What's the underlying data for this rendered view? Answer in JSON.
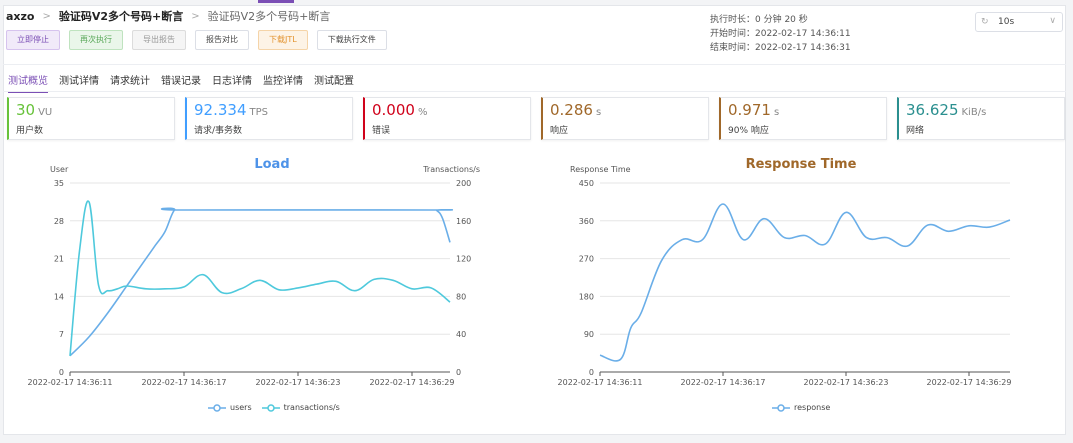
{
  "breadcrumb": {
    "project": "axzo",
    "scenario": "验证码V2多个号码+断言",
    "report": "验证码V2多个号码+断言"
  },
  "buttons": {
    "stop": "立即停止",
    "rerun": "再次执行",
    "export": "导出报告",
    "compare": "报告对比",
    "download_jtl": "下载JTL",
    "download_files": "下载执行文件"
  },
  "info": {
    "duration": "执行时长：0 分钟 20 秒",
    "start": "开始时间：2022-02-17 14:36:11",
    "end": "结束时间：2022-02-17 14:36:31"
  },
  "refresh_select": {
    "value": "10s"
  },
  "tabs": [
    "测试概览",
    "测试详情",
    "请求统计",
    "错误记录",
    "日志详情",
    "监控详情",
    "测试配置"
  ],
  "metrics": [
    {
      "value": "30",
      "unit": "VU",
      "label": "用户数",
      "color": "#67c23a"
    },
    {
      "value": "92.334",
      "unit": "TPS",
      "label": "请求/事务数",
      "color": "#409eff"
    },
    {
      "value": "0.000",
      "unit": "%",
      "label": "错误",
      "color": "#d0021b"
    },
    {
      "value": "0.286",
      "unit": "s",
      "label": "响应",
      "color": "#a0682a"
    },
    {
      "value": "0.971",
      "unit": "s",
      "label": "90% 响应",
      "color": "#a0682a"
    },
    {
      "value": "36.625",
      "unit": "KiB/s",
      "label": "网络",
      "color": "#2a8f8f"
    }
  ],
  "chart_data": [
    {
      "type": "line",
      "title": "Load",
      "title_color": "#4e93e8",
      "ylabel": "User",
      "y2label": "Transactions/s",
      "ylim": [
        0,
        35
      ],
      "y2lim": [
        0,
        200
      ],
      "yticks": [
        0,
        7,
        14,
        21,
        28,
        35
      ],
      "y2ticks": [
        0,
        40,
        80,
        120,
        160,
        200
      ],
      "xlim": [
        0,
        20
      ],
      "xticks": [
        "2022-02-17 14:36:11",
        "2022-02-17 14:36:17",
        "2022-02-17 14:36:23",
        "2022-02-17 14:36:29"
      ],
      "grid": true,
      "legend": "bottom",
      "series": [
        {
          "name": "users",
          "axis": "left",
          "color": "#6aaee8",
          "x": [
            0,
            1,
            2,
            3,
            4,
            4.5,
            5,
            5.5,
            6,
            19,
            19.3,
            19.6,
            20
          ],
          "values": [
            3,
            6.5,
            11,
            16,
            21,
            23.5,
            26,
            30,
            30,
            30,
            29.9,
            28.5,
            24
          ]
        },
        {
          "name": "transactions/s",
          "axis": "right",
          "color": "#4ec9dc",
          "x": [
            0,
            0.5,
            1,
            1.5,
            2,
            2.5,
            3,
            4,
            5,
            6,
            7,
            8,
            9,
            10,
            11,
            12,
            13,
            14,
            15,
            16,
            17,
            18,
            19,
            20
          ],
          "values": [
            17,
            128,
            180,
            92,
            86,
            88,
            91,
            88,
            88,
            90,
            103,
            84,
            88,
            97,
            87,
            89,
            93,
            96,
            86,
            98,
            97,
            88,
            89,
            74
          ]
        }
      ]
    },
    {
      "type": "line",
      "title": "Response Time",
      "title_color": "#a0682a",
      "ylabel": "Response Time",
      "ylim": [
        0,
        450
      ],
      "yticks": [
        0,
        90,
        180,
        270,
        360,
        450
      ],
      "xlim": [
        0,
        20
      ],
      "xticks": [
        "2022-02-17 14:36:11",
        "2022-02-17 14:36:17",
        "2022-02-17 14:36:23",
        "2022-02-17 14:36:29"
      ],
      "grid": true,
      "legend": "bottom",
      "series": [
        {
          "name": "response",
          "axis": "left",
          "color": "#6aaee8",
          "x": [
            0,
            1,
            1.5,
            2,
            3,
            4,
            5,
            6,
            7,
            8,
            9,
            10,
            11,
            12,
            13,
            14,
            15,
            16,
            17,
            18,
            19,
            20
          ],
          "values": [
            40,
            30,
            105,
            140,
            265,
            315,
            315,
            400,
            315,
            365,
            320,
            325,
            305,
            380,
            320,
            320,
            300,
            350,
            335,
            348,
            345,
            362
          ]
        }
      ]
    }
  ]
}
